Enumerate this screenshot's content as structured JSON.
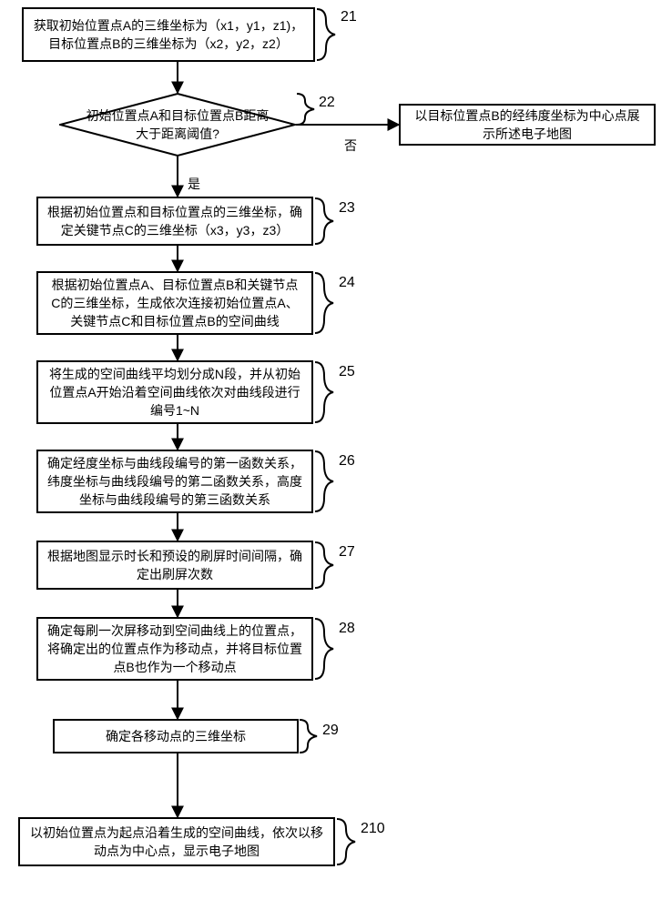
{
  "steps": {
    "s21": {
      "num": "21",
      "text": "获取初始位置点A的三维坐标为（x1，y1，z1)，目标位置点B的三维坐标为（x2，y2，z2）"
    },
    "s22": {
      "num": "22",
      "text": "初始位置点A和目标位置点B距离大于距离阈值?"
    },
    "s22_no_result": {
      "text": "以目标位置点B的经纬度坐标为中心点展示所述电子地图"
    },
    "s23": {
      "num": "23",
      "text": "根据初始位置点和目标位置点的三维坐标，确定关键节点C的三维坐标（x3，y3，z3）"
    },
    "s24": {
      "num": "24",
      "text": "根据初始位置点A、目标位置点B和关键节点C的三维坐标，生成依次连接初始位置点A、关键节点C和目标位置点B的空间曲线"
    },
    "s25": {
      "num": "25",
      "text": "将生成的空间曲线平均划分成N段，并从初始位置点A开始沿着空间曲线依次对曲线段进行编号1~N"
    },
    "s26": {
      "num": "26",
      "text": "确定经度坐标与曲线段编号的第一函数关系，纬度坐标与曲线段编号的第二函数关系，高度坐标与曲线段编号的第三函数关系"
    },
    "s27": {
      "num": "27",
      "text": "根据地图显示时长和预设的刷屏时间间隔，确定出刷屏次数"
    },
    "s28": {
      "num": "28",
      "text": "确定每刷一次屏移动到空间曲线上的位置点，将确定出的位置点作为移动点，并将目标位置点B也作为一个移动点"
    },
    "s29": {
      "num": "29",
      "text": "确定各移动点的三维坐标"
    },
    "s210": {
      "num": "210",
      "text": "以初始位置点为起点沿着生成的空间曲线，依次以移动点为中心点，显示电子地图"
    }
  },
  "labels": {
    "yes": "是",
    "no": "否"
  }
}
